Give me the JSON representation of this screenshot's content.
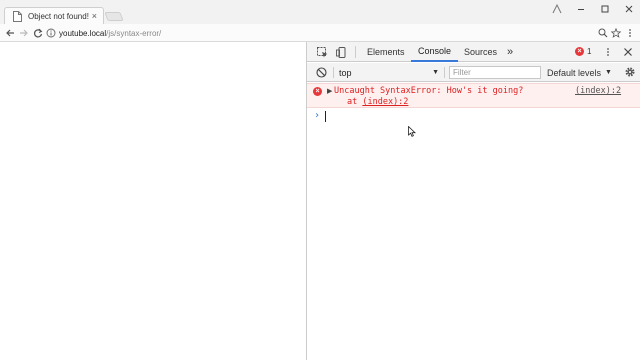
{
  "browser": {
    "tab_title": "Object not found!",
    "tab_close": "×",
    "url_host": "youtube.local",
    "url_path": "/js/syntax-error/",
    "icons": [
      "page-icon",
      "back-icon",
      "forward-icon",
      "reload-icon",
      "info-icon",
      "zoom-icon",
      "star-icon",
      "menu-icon",
      "minimize-icon",
      "maximize-icon",
      "close-icon",
      "user-icon"
    ]
  },
  "devtools": {
    "tabs": [
      {
        "label": "Elements",
        "active": false
      },
      {
        "label": "Console",
        "active": true
      },
      {
        "label": "Sources",
        "active": false
      }
    ],
    "more_tabs": "»",
    "error_count": "1",
    "error_glyph": "×",
    "context": "top",
    "filter_placeholder": "Filter",
    "levels_label": "Default levels",
    "caret": "▼",
    "close": "✕"
  },
  "console": {
    "error": {
      "message": "Uncaught SyntaxError: How's it going?",
      "at_prefix": "at ",
      "at_link": "(index):2",
      "source": "(index):2"
    },
    "prompt": "›"
  },
  "colors": {
    "accent": "#3879d9",
    "error": "#e6383a",
    "error_bg": "#fff0f0"
  }
}
